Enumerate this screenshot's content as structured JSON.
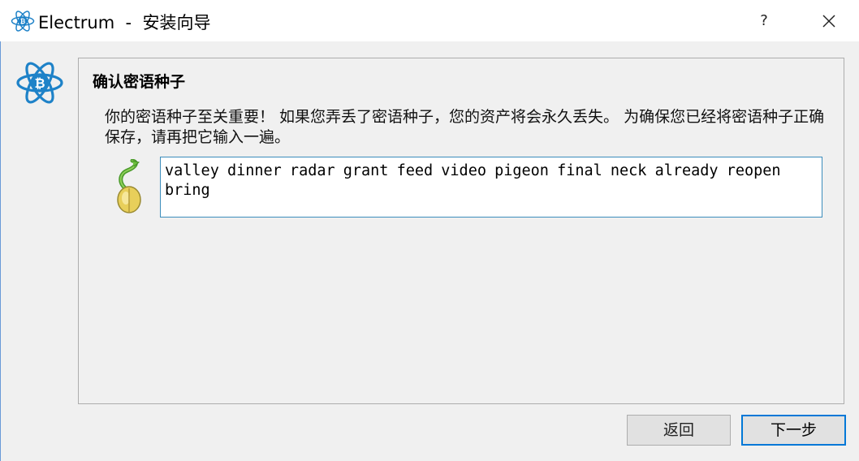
{
  "window": {
    "title": "Electrum  -  安装向导",
    "help_label": "?"
  },
  "panel": {
    "heading": "确认密语种子",
    "message": "你的密语种子至关重要！ 如果您弄丢了密语种子，您的资产将会永久丢失。 为确保您已经将密语种子正确保存，请再把它输入一遍。",
    "seed_text": "valley dinner radar grant feed video pigeon final neck already reopen bring"
  },
  "buttons": {
    "back_label": "返回",
    "next_label": "下一步"
  },
  "colors": {
    "accent": "#0078d7",
    "logo_blue": "#1e82c8"
  }
}
